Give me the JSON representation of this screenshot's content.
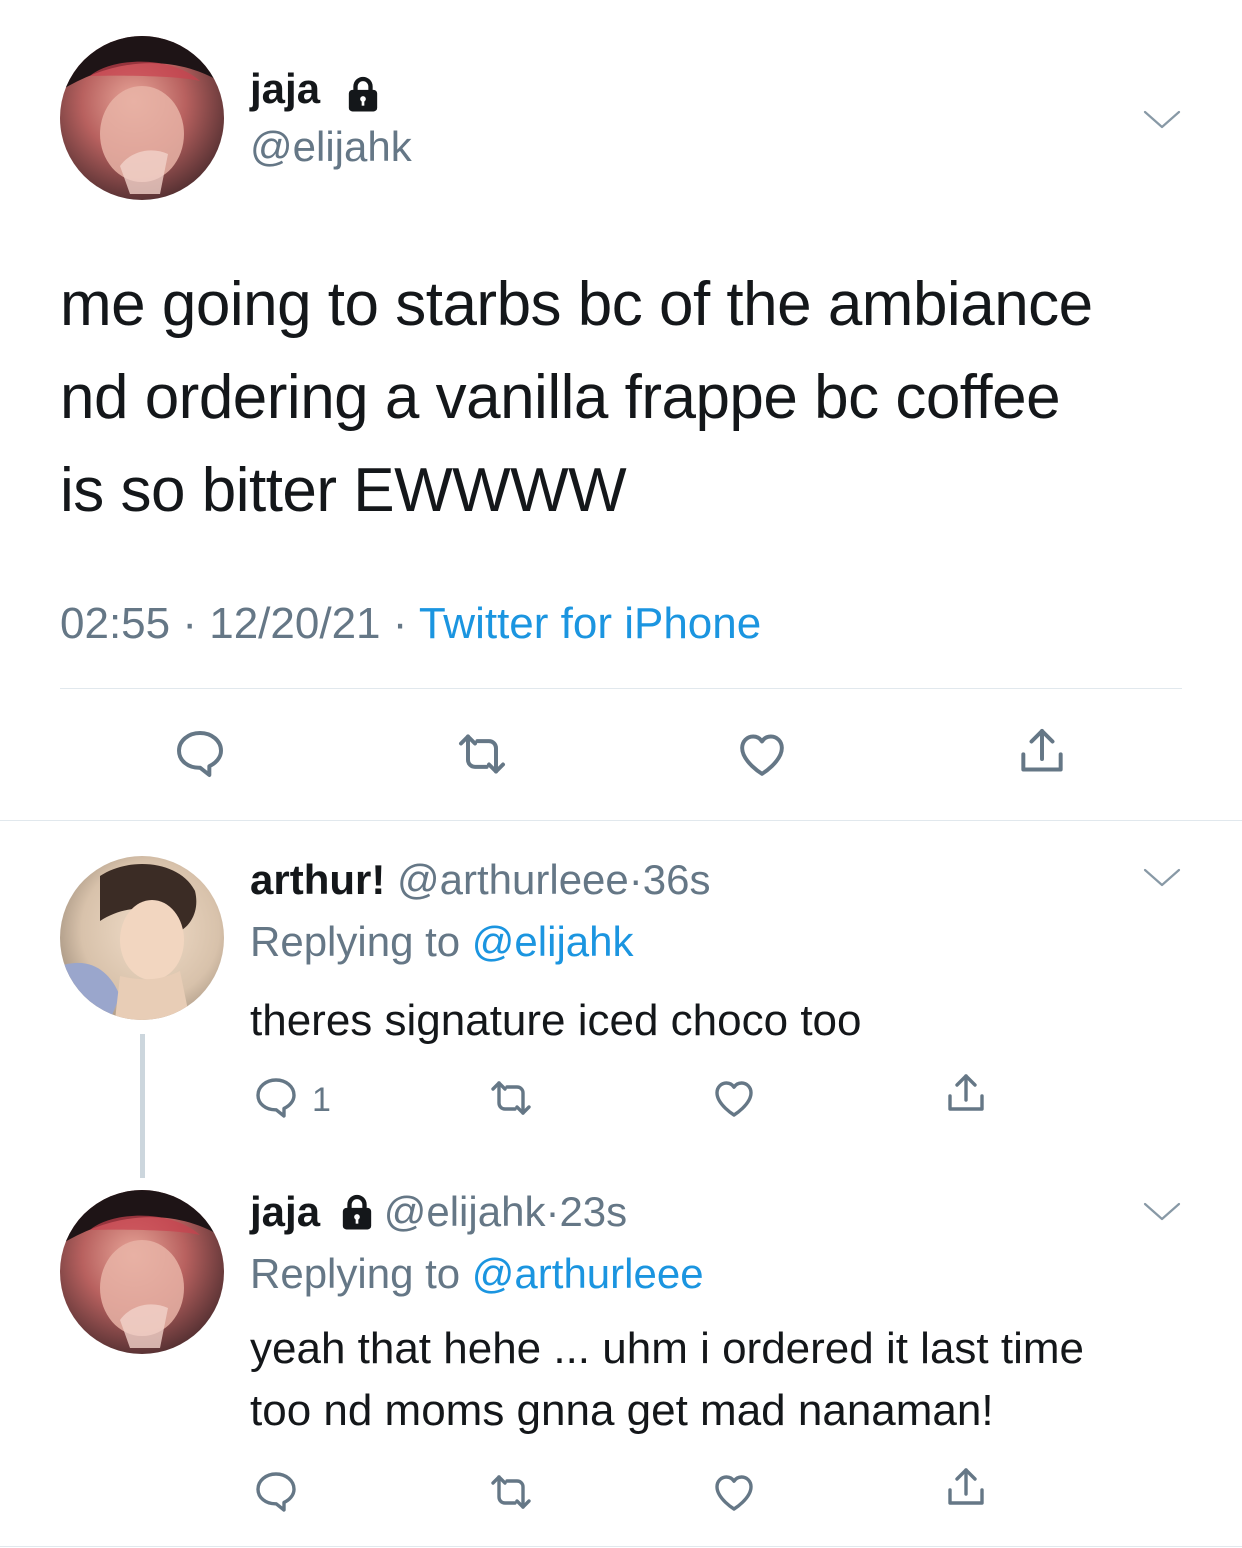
{
  "main_tweet": {
    "display_name": "jaja",
    "handle": "@elijahk",
    "text_lines": [
      "me going to starbs bc of the ambiance",
      "nd ordering a vanilla frappe bc coffee",
      "is so bitter EWWWW"
    ],
    "time": "02:55",
    "date": "12/20/21",
    "separator": "·",
    "source": "Twitter for iPhone"
  },
  "replies": [
    {
      "display_name": "arthur!",
      "handle": "@arthurleee",
      "separator": "·",
      "age": "36s",
      "replying_label": "Replying to",
      "replying_handle": "@elijahk",
      "text_lines": [
        "theres signature iced choco too"
      ],
      "reply_count": "1"
    },
    {
      "display_name": "jaja",
      "handle": "@elijahk",
      "separator": "·",
      "age": "23s",
      "replying_label": "Replying to",
      "replying_handle": "@arthurleee",
      "text_lines": [
        "yeah that hehe ... uhm i ordered it last time",
        "too nd moms gnna get mad nanaman!"
      ]
    }
  ],
  "icons": {
    "lock": "lock-icon",
    "chevron": "chevron-down-icon",
    "reply": "reply-bubble-icon",
    "retweet": "retweet-icon",
    "like": "heart-icon",
    "share": "share-icon"
  },
  "colors": {
    "text": "#14171a",
    "secondary": "#657786",
    "link": "#1b95e0",
    "divider": "#e1e8ed",
    "thread_line": "#ccd6dd"
  }
}
